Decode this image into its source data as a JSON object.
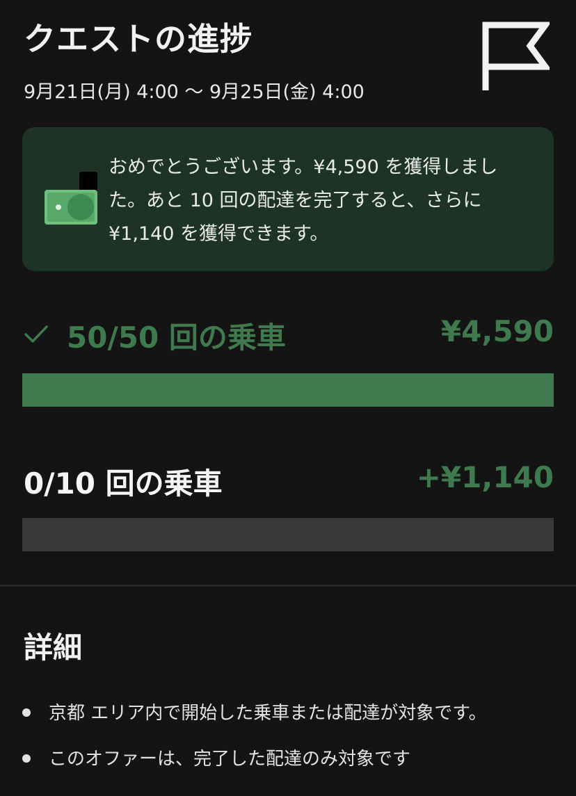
{
  "header": {
    "title": "クエストの進捗",
    "date_range": "9月21日(月) 4:00 〜 9月25日(金) 4:00",
    "icon": "flag-icon"
  },
  "banner": {
    "icon": "money-icon",
    "message": "おめでとうございます。¥4,590 を獲得しました。あと 10 回の配達を完了すると、さらに ¥1,140 を獲得できます。",
    "background_color": "#1d3326"
  },
  "quests": [
    {
      "label": "50/50 回の乗車",
      "amount": "¥4,590",
      "completed": true,
      "progress": 1.0,
      "icon": "check-icon"
    },
    {
      "label": "0/10 回の乗車",
      "amount": "+¥1,140",
      "completed": false,
      "progress": 0.0
    }
  ],
  "details": {
    "heading": "詳細",
    "items": [
      "京都 エリア内で開始した乗車または配達が対象です。",
      "このオファーは、完了した配達のみ対象です"
    ]
  },
  "colors": {
    "background": "#141414",
    "accent_green": "#3f7a4e",
    "track_gray": "#3a3a3a"
  }
}
